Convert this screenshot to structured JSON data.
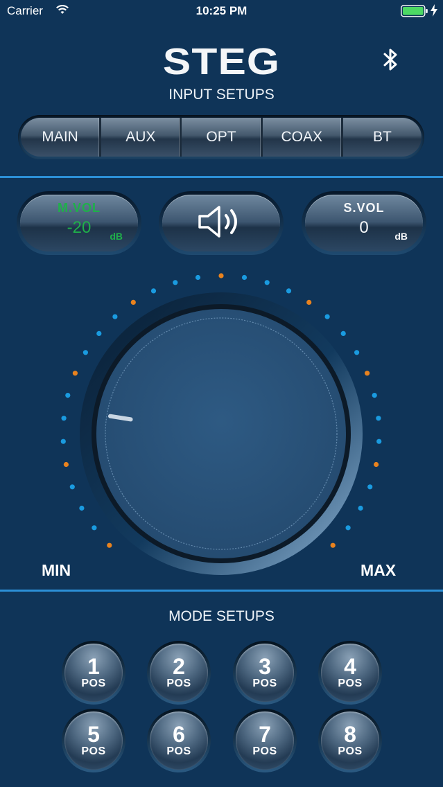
{
  "status_bar": {
    "carrier": "Carrier",
    "time": "10:25 PM",
    "wifi_icon": "wifi-icon",
    "battery_icon": "battery-icon",
    "battery_color": "#4cd964"
  },
  "header": {
    "logo": "STEG",
    "bluetooth_icon": "bluetooth-icon"
  },
  "input_setups": {
    "title": "INPUT SETUPS",
    "segments": [
      "MAIN",
      "AUX",
      "OPT",
      "COAX",
      "BT"
    ]
  },
  "volume": {
    "master": {
      "label": "M.VOL",
      "value": "-20",
      "unit": "dB",
      "color": "#1fb04a"
    },
    "mute_icon": "speaker-icon",
    "sub": {
      "label": "S.VOL",
      "value": "0",
      "unit": "dB"
    }
  },
  "knob": {
    "min_label": "MIN",
    "max_label": "MAX",
    "level": 0.2,
    "accent_blue": "#1a9be0",
    "accent_orange": "#e8821e"
  },
  "mode_setups": {
    "title": "MODE SETUPS",
    "buttons": [
      {
        "number": "1",
        "label": "POS"
      },
      {
        "number": "2",
        "label": "POS"
      },
      {
        "number": "3",
        "label": "POS"
      },
      {
        "number": "4",
        "label": "POS"
      },
      {
        "number": "5",
        "label": "POS"
      },
      {
        "number": "6",
        "label": "POS"
      },
      {
        "number": "7",
        "label": "POS"
      },
      {
        "number": "8",
        "label": "POS"
      }
    ]
  }
}
